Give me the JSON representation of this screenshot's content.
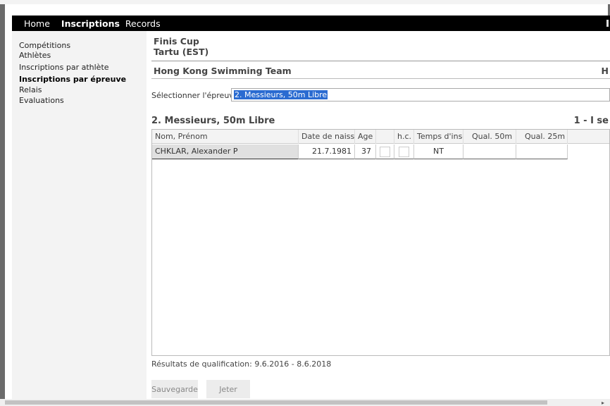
{
  "nav": {
    "items": [
      {
        "label": "Home"
      },
      {
        "label": "Inscriptions"
      },
      {
        "label": "Records"
      }
    ]
  },
  "sidebar": {
    "items": [
      {
        "label": "Compétitions"
      },
      {
        "label": "Athlètes"
      },
      {
        "label": "Inscriptions par athlète"
      },
      {
        "label": "Inscriptions par épreuve"
      },
      {
        "label": "Relais"
      },
      {
        "label": "Evaluations"
      }
    ]
  },
  "meet": {
    "name": "Finis Cup",
    "location": "Tartu (EST)"
  },
  "team": {
    "name": "Hong Kong Swimming Team",
    "right_label": "H"
  },
  "event_select": {
    "label": "Sélectionner l'épreuve:",
    "value": "2. Messieurs, 50m Libre"
  },
  "event": {
    "title": "2. Messieurs, 50m Libre",
    "page_info": "1 - I se"
  },
  "table": {
    "columns": [
      "Nom, Prénom",
      "Date de naissa",
      "Age",
      "",
      "h.c.",
      "Temps d'insc",
      "Qual. 50m",
      "Qual. 25m",
      ""
    ],
    "rows": [
      {
        "name": "CHKLAR, Alexander P",
        "birth_date": "21.7.1981",
        "age": "37",
        "time": "NT",
        "qual50": "",
        "qual25": ""
      }
    ]
  },
  "qualification": {
    "text": "Résultats de qualification: 9.6.2016 - 8.6.2018"
  },
  "buttons": {
    "save": "Sauvegarde",
    "discard": "Jeter"
  },
  "colors": {
    "navbar": "#000000",
    "selection": "#2a6bd1",
    "row_highlight": "#e0e0e0"
  }
}
